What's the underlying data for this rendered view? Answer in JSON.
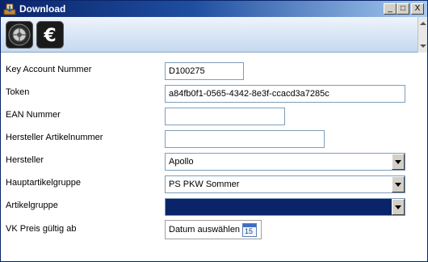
{
  "window": {
    "title": "Download",
    "buttons": {
      "minimize": "_",
      "maximize": "□",
      "close": "X"
    }
  },
  "toolbar": {
    "items": [
      {
        "icon": "tire-icon"
      },
      {
        "icon": "euro-icon"
      }
    ]
  },
  "form": {
    "key_account": {
      "label": "Key Account Nummer",
      "value": "D100275"
    },
    "token": {
      "label": "Token",
      "value": "a84fb0f1-0565-4342-8e3f-ccacd3a7285c"
    },
    "ean": {
      "label": "EAN Nummer",
      "value": ""
    },
    "hersteller_artikelnummer": {
      "label": "Hersteller Artikelnummer",
      "value": ""
    },
    "hersteller": {
      "label": "Hersteller",
      "value": "Apollo"
    },
    "hauptartikelgruppe": {
      "label": "Hauptartikelgruppe",
      "value": "PS PKW Sommer"
    },
    "artikelgruppe": {
      "label": "Artikelgruppe",
      "value": ""
    },
    "vk_preis": {
      "label": "VK Preis gültig ab",
      "button": "Datum auswählen",
      "calendar_day": "15"
    }
  },
  "colors": {
    "title_bar": "#0a246a",
    "selection": "#0a246a",
    "toolbar": "#c5d9ef"
  }
}
